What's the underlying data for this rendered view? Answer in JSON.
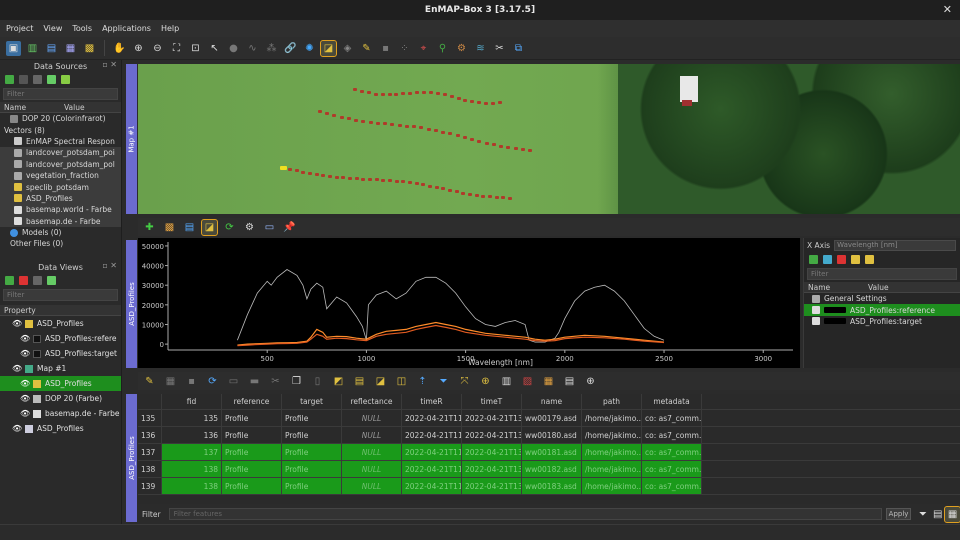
{
  "window": {
    "title": "EnMAP-Box 3 [3.17.5]"
  },
  "menu": [
    "Project",
    "View",
    "Tools",
    "Applications",
    "Help"
  ],
  "data_sources": {
    "title": "Data Sources",
    "filter_placeholder": "Filter",
    "columns": [
      "Name",
      "Value"
    ],
    "items": [
      {
        "label": "DOP 20 (Colorinfrarot)",
        "icon": "raster-icon",
        "color": "#888888"
      },
      {
        "label": "Vectors (8)",
        "icon": "folder-icon",
        "color": "#666666"
      },
      {
        "label": "EnMAP Spectral Respon",
        "icon": "table-icon",
        "color": "#cccccc"
      },
      {
        "label": "landcover_potsdam_poi",
        "icon": "vector-icon",
        "color": "#aaaaaa"
      },
      {
        "label": "landcover_potsdam_pol",
        "icon": "vector-icon",
        "color": "#aaaaaa"
      },
      {
        "label": "vegetation_fraction",
        "icon": "vector-icon",
        "color": "#aaaaaa"
      },
      {
        "label": "speclib_potsdam",
        "icon": "speclib-icon",
        "color": "#e0c040"
      },
      {
        "label": "ASD_Profiles",
        "icon": "speclib-icon",
        "color": "#e0c040"
      },
      {
        "label": "basemap.world - Farbe",
        "icon": "grid-icon",
        "color": "#dddddd"
      },
      {
        "label": "basemap.de - Farbe",
        "icon": "grid-icon",
        "color": "#dddddd"
      },
      {
        "label": "Models (0)",
        "icon": "gear-icon",
        "color": "#4090e0"
      },
      {
        "label": "Other Files (0)",
        "icon": "none",
        "color": "#000000"
      }
    ]
  },
  "data_views": {
    "title": "Data Views",
    "filter_placeholder": "Filter",
    "property_header": "Property",
    "items": [
      {
        "label": "ASD_Profiles",
        "indent": 0,
        "selected": false
      },
      {
        "label": "ASD_Profiles:refere",
        "indent": 1,
        "selected": false
      },
      {
        "label": "ASD_Profiles:target",
        "indent": 1,
        "selected": false
      },
      {
        "label": "Map #1",
        "indent": 0,
        "selected": false
      },
      {
        "label": "ASD_Profiles",
        "indent": 1,
        "selected": true
      },
      {
        "label": "DOP 20 (Farbe)",
        "indent": 1,
        "selected": false
      },
      {
        "label": "basemap.de - Farbe",
        "indent": 1,
        "selected": false
      },
      {
        "label": "ASD_Profiles",
        "indent": 0,
        "selected": false
      }
    ]
  },
  "map": {
    "tab": "Map #1"
  },
  "profiles": {
    "tab": "ASD_Profiles",
    "x_axis_label": "X Axis",
    "x_axis_value": "Wavelength [nm]",
    "filter_placeholder": "Filter",
    "columns": [
      "Name",
      "Value"
    ],
    "general_settings": "General Settings",
    "entries": [
      "ASD_Profiles:reference",
      "ASD_Profiles:target"
    ]
  },
  "chart_data": {
    "type": "line",
    "xlabel": "Wavelength [nm]",
    "ylabel": "",
    "xlim": [
      0,
      3150
    ],
    "ylim": [
      -3000,
      52000
    ],
    "xticks": [
      500,
      1000,
      1500,
      2000,
      2500,
      3000
    ],
    "yticks": [
      0,
      10000,
      20000,
      30000,
      40000,
      50000
    ],
    "ytick_labels": [
      "0",
      "10000",
      "20000",
      "30000",
      "40000",
      "50000"
    ],
    "grid": false,
    "series": [
      {
        "color": "#bbbbbb",
        "x": [
          350,
          400,
          450,
          500,
          520,
          550,
          600,
          650,
          680,
          700,
          720,
          750,
          780,
          800,
          850,
          900,
          950,
          980,
          1000,
          1010,
          1050,
          1100,
          1150,
          1200,
          1250,
          1300,
          1350,
          1400,
          1450,
          1500,
          1550,
          1600,
          1650,
          1700,
          1750,
          1800,
          1820,
          1850,
          1900,
          1950,
          1970,
          2000,
          2050,
          2100,
          2150,
          2200,
          2250,
          2300,
          2350,
          2400,
          2450,
          2500
        ],
        "y": [
          2000,
          15000,
          26000,
          32000,
          30000,
          34000,
          38000,
          35000,
          30000,
          23000,
          28000,
          31000,
          29000,
          18000,
          24000,
          21000,
          14000,
          9000,
          2000,
          20000,
          25000,
          27000,
          23000,
          26000,
          32000,
          34000,
          34000,
          31000,
          26000,
          19000,
          13000,
          10000,
          9000,
          11000,
          12000,
          10000,
          2000,
          1000,
          1000,
          3000,
          6000,
          13000,
          22000,
          27000,
          29000,
          30000,
          27000,
          22000,
          15000,
          8000,
          4000,
          2000
        ]
      },
      {
        "color": "#ff8c2a",
        "x": [
          350,
          400,
          450,
          500,
          550,
          600,
          650,
          700,
          720,
          750,
          780,
          800,
          850,
          900,
          950,
          1000,
          1050,
          1100,
          1150,
          1200,
          1250,
          1300,
          1350,
          1400,
          1450,
          1500,
          1600,
          1700,
          1800,
          1850,
          1900,
          1950,
          2000,
          2100,
          2200,
          2300,
          2400,
          2500
        ],
        "y": [
          -500,
          0,
          200,
          400,
          600,
          700,
          800,
          1500,
          3500,
          7500,
          6000,
          3500,
          4000,
          3800,
          3000,
          2500,
          5000,
          6500,
          7000,
          7500,
          9000,
          10000,
          11000,
          10000,
          9000,
          7500,
          5500,
          4500,
          3500,
          2500,
          2000,
          2500,
          3500,
          4500,
          4000,
          3000,
          2000,
          1000
        ]
      },
      {
        "color": "#e05a20",
        "x": [
          350,
          400,
          450,
          500,
          550,
          600,
          650,
          700,
          720,
          750,
          780,
          800,
          850,
          900,
          950,
          1000,
          1050,
          1100,
          1150,
          1200,
          1250,
          1300,
          1350,
          1400,
          1450,
          1500,
          1600,
          1700,
          1800,
          1850,
          1900,
          1950,
          2000,
          2100,
          2200,
          2300,
          2400,
          2500
        ],
        "y": [
          -800,
          -500,
          -200,
          0,
          200,
          300,
          400,
          1000,
          2500,
          5000,
          4000,
          2500,
          3000,
          2800,
          2200,
          1800,
          4000,
          5000,
          5500,
          6000,
          7500,
          8500,
          9500,
          8500,
          7500,
          6000,
          4500,
          3500,
          2500,
          1800,
          1500,
          1800,
          2800,
          3500,
          3200,
          2500,
          1500,
          800
        ]
      }
    ]
  },
  "table": {
    "columns": [
      "",
      "fid",
      "reference",
      "target",
      "reflectance",
      "timeR",
      "timeT",
      "name",
      "path",
      "metadata"
    ],
    "rows": [
      {
        "id": "135",
        "selected": false,
        "cells": [
          "135",
          "135",
          "Profile",
          "Profile",
          "NULL",
          "2022-04-21T11...",
          "2022-04-21T13...",
          "ww00179.asd",
          "/home/jakimo...",
          "co: as7_comm..."
        ]
      },
      {
        "id": "136",
        "selected": false,
        "cells": [
          "136",
          "136",
          "Profile",
          "Profile",
          "NULL",
          "2022-04-21T11...",
          "2022-04-21T13...",
          "ww00180.asd",
          "/home/jakimo...",
          "co: as7_comm..."
        ]
      },
      {
        "id": "137",
        "selected": true,
        "cells": [
          "137",
          "137",
          "Profile",
          "Profile",
          "NULL",
          "2022-04-21T11...",
          "2022-04-21T13...",
          "ww00181.asd",
          "/home/jakimo...",
          "co: as7_comm..."
        ]
      },
      {
        "id": "138",
        "selected": true,
        "cells": [
          "138",
          "138",
          "Profile",
          "Profile",
          "NULL",
          "2022-04-21T11...",
          "2022-04-21T13...",
          "ww00182.asd",
          "/home/jakimo...",
          "co: as7_comm..."
        ]
      },
      {
        "id": "139",
        "selected": true,
        "cells": [
          "139",
          "138",
          "Profile",
          "Profile",
          "NULL",
          "2022-04-21T11...",
          "2022-04-21T13...",
          "ww00183.asd",
          "/home/jakimo...",
          "co: as7_comm..."
        ]
      }
    ]
  },
  "filter": {
    "label": "Filter",
    "placeholder": "Filter features",
    "apply": "Apply"
  },
  "colors": {
    "accent": "#6b6bd0",
    "selection": "#1e8e1e",
    "reference_line": "#bbbbbb",
    "target_line": "#ff8c2a"
  }
}
